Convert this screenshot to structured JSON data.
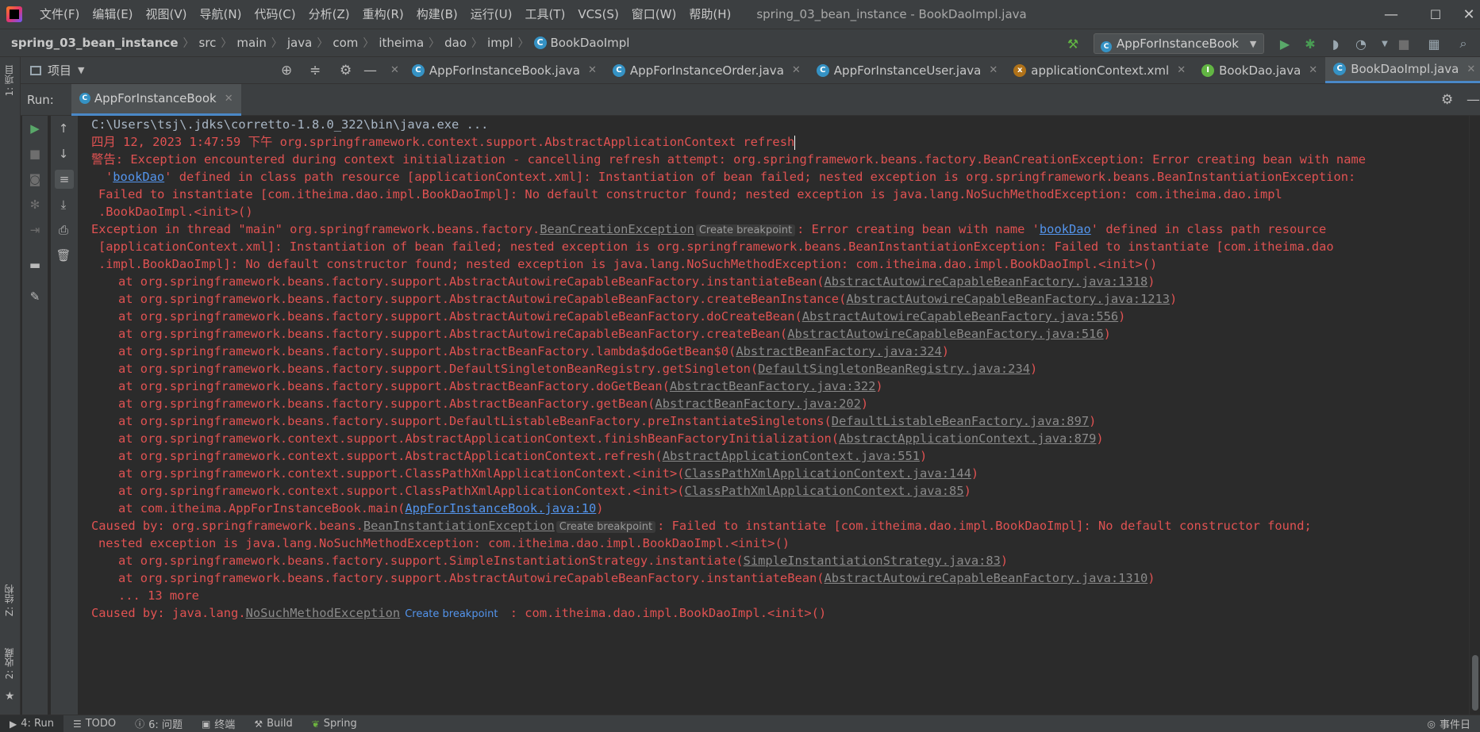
{
  "titlebar": {
    "menu": [
      "文件(F)",
      "编辑(E)",
      "视图(V)",
      "导航(N)",
      "代码(C)",
      "分析(Z)",
      "重构(R)",
      "构建(B)",
      "运行(U)",
      "工具(T)",
      "VCS(S)",
      "窗口(W)",
      "帮助(H)"
    ],
    "title": "spring_03_bean_instance - BookDaoImpl.java",
    "minimize": "—",
    "maximize": "☐",
    "close": "✕"
  },
  "breadcrumbs": [
    "spring_03_bean_instance",
    "src",
    "main",
    "java",
    "com",
    "itheima",
    "dao",
    "impl",
    "BookDaoImpl"
  ],
  "run_config": "AppForInstanceBook",
  "left_strip": {
    "project": "1: 项目",
    "structure": "Z: 结构",
    "favorites": "2: 收藏"
  },
  "project_panel": {
    "title": "项目"
  },
  "tabs": [
    {
      "label": "AppForInstanceBook.java",
      "icon": "C",
      "color": "#3592c4"
    },
    {
      "label": "AppForInstanceOrder.java",
      "icon": "C",
      "color": "#3592c4"
    },
    {
      "label": "AppForInstanceUser.java",
      "icon": "C",
      "color": "#3592c4"
    },
    {
      "label": "applicationContext.xml",
      "icon": "x",
      "color": "#b07219"
    },
    {
      "label": "BookDao.java",
      "icon": "I",
      "color": "#62b543"
    },
    {
      "label": "BookDaoImpl.java",
      "icon": "C",
      "color": "#3592c4"
    }
  ],
  "run_panel": {
    "label": "Run:",
    "tab": "AppForInstanceBook"
  },
  "console": {
    "cmd": "C:\\Users\\tsj\\.jdks\\corretto-1.8.0_322\\bin\\java.exe ...",
    "l1": "四月 12, 2023 1:47:59 下午 org.springframework.context.support.AbstractApplicationContext refresh",
    "l2": "警告: Exception encountered during context initialization - cancelling refresh attempt: org.springframework.beans.factory.BeanCreationException: Error creating bean with name",
    "l3a": "'",
    "l3link": "bookDao",
    "l3b": "' defined in class path resource [applicationContext.xml]: Instantiation of bean failed; nested exception is org.springframework.beans.BeanInstantiationException:",
    "l4": "Failed to instantiate [com.itheima.dao.impl.BookDaoImpl]: No default constructor found; nested exception is java.lang.NoSuchMethodException: com.itheima.dao.impl",
    "l5": ".BookDaoImpl.<init>()",
    "l6a": "Exception in thread \"main\" org.springframework.beans.factory.",
    "l6link": "BeanCreationException",
    "bp": "Create breakpoint",
    "l6b": ": Error creating bean with name '",
    "l6link2": "bookDao",
    "l6c": "' defined in class path resource",
    "l7": "[applicationContext.xml]: Instantiation of bean failed; nested exception is org.springframework.beans.BeanInstantiationException: Failed to instantiate [com.itheima.dao",
    "l8": ".impl.BookDaoImpl]: No default constructor found; nested exception is java.lang.NoSuchMethodException: com.itheima.dao.impl.BookDaoImpl.<init>()",
    "stack": [
      {
        "t": "at org.springframework.beans.factory.support.AbstractAutowireCapableBeanFactory.instantiateBean(",
        "l": "AbstractAutowireCapableBeanFactory.java:1318"
      },
      {
        "t": "at org.springframework.beans.factory.support.AbstractAutowireCapableBeanFactory.createBeanInstance(",
        "l": "AbstractAutowireCapableBeanFactory.java:1213"
      },
      {
        "t": "at org.springframework.beans.factory.support.AbstractAutowireCapableBeanFactory.doCreateBean(",
        "l": "AbstractAutowireCapableBeanFactory.java:556"
      },
      {
        "t": "at org.springframework.beans.factory.support.AbstractAutowireCapableBeanFactory.createBean(",
        "l": "AbstractAutowireCapableBeanFactory.java:516"
      },
      {
        "t": "at org.springframework.beans.factory.support.AbstractBeanFactory.lambda$doGetBean$0(",
        "l": "AbstractBeanFactory.java:324"
      },
      {
        "t": "at org.springframework.beans.factory.support.DefaultSingletonBeanRegistry.getSingleton(",
        "l": "DefaultSingletonBeanRegistry.java:234"
      },
      {
        "t": "at org.springframework.beans.factory.support.AbstractBeanFactory.doGetBean(",
        "l": "AbstractBeanFactory.java:322"
      },
      {
        "t": "at org.springframework.beans.factory.support.AbstractBeanFactory.getBean(",
        "l": "AbstractBeanFactory.java:202"
      },
      {
        "t": "at org.springframework.beans.factory.support.DefaultListableBeanFactory.preInstantiateSingletons(",
        "l": "DefaultListableBeanFactory.java:897"
      },
      {
        "t": "at org.springframework.context.support.AbstractApplicationContext.finishBeanFactoryInitialization(",
        "l": "AbstractApplicationContext.java:879"
      },
      {
        "t": "at org.springframework.context.support.AbstractApplicationContext.refresh(",
        "l": "AbstractApplicationContext.java:551"
      },
      {
        "t": "at org.springframework.context.support.ClassPathXmlApplicationContext.<init>(",
        "l": "ClassPathXmlApplicationContext.java:144"
      },
      {
        "t": "at org.springframework.context.support.ClassPathXmlApplicationContext.<init>(",
        "l": "ClassPathXmlApplicationContext.java:85"
      },
      {
        "t": "at com.itheima.AppForInstanceBook.main(",
        "l": "AppForInstanceBook.java:10",
        "blue": true
      }
    ],
    "c1a": "Caused by: org.springframework.beans.",
    "c1link": "BeanInstantiationException",
    "c1b": ": Failed to instantiate [com.itheima.dao.impl.BookDaoImpl]: No default constructor found;",
    "c2": "nested exception is java.lang.NoSuchMethodException: com.itheima.dao.impl.BookDaoImpl.<init>()",
    "stack2": [
      {
        "t": "at org.springframework.beans.factory.support.SimpleInstantiationStrategy.instantiate(",
        "l": "SimpleInstantiationStrategy.java:83"
      },
      {
        "t": "at org.springframework.beans.factory.support.AbstractAutowireCapableBeanFactory.instantiateBean(",
        "l": "AbstractAutowireCapableBeanFactory.java:1310"
      }
    ],
    "more": "... 13 more",
    "c3a": "Caused by: java.lang.",
    "c3link": "NoSuchMethodException",
    "c3b": " : com.itheima.dao.impl.BookDaoImpl.<init>()"
  },
  "bottombar": {
    "run": "4: Run",
    "todo": "TODO",
    "problems": "6: 问题",
    "terminal": "终端",
    "build": "Build",
    "spring": "Spring",
    "event_log": "事件日"
  }
}
